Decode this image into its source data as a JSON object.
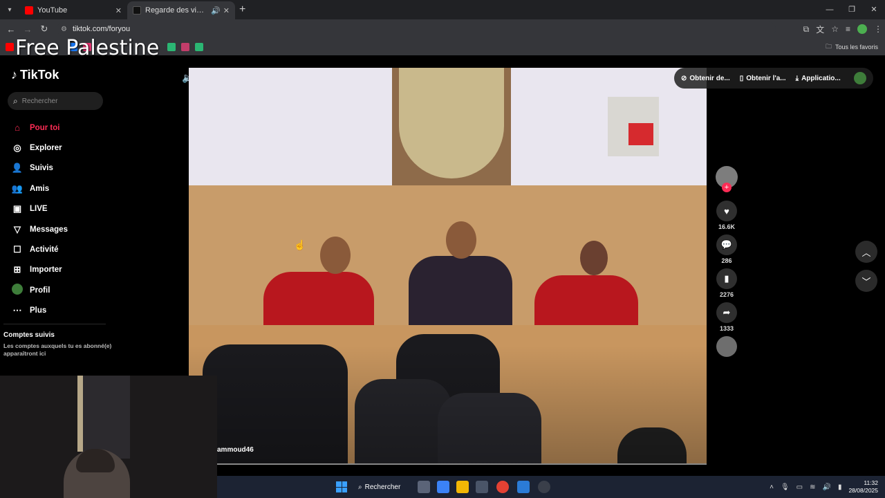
{
  "browser": {
    "tabs": [
      {
        "title": "YouTube",
        "favicon_color": "#ff0000",
        "active": false
      },
      {
        "title": "Regarde des vidéos tendan...",
        "favicon_color": "#111111",
        "active": true
      }
    ],
    "new_tab_symbol": "+",
    "url": "tiktok.com/foryou",
    "bookmarks_all_label": "Tous les favoris",
    "overlay_text": "Free Palestine"
  },
  "tiktok": {
    "logo_text": "TikTok",
    "search_placeholder": "Rechercher",
    "menu": [
      {
        "label": "Pour toi",
        "icon": "home-icon",
        "active": true
      },
      {
        "label": "Explorer",
        "icon": "compass-icon",
        "active": false
      },
      {
        "label": "Suivis",
        "icon": "following-icon",
        "active": false
      },
      {
        "label": "Amis",
        "icon": "friends-icon",
        "active": false
      },
      {
        "label": "LIVE",
        "icon": "live-icon",
        "active": false
      },
      {
        "label": "Messages",
        "icon": "messages-icon",
        "active": false
      },
      {
        "label": "Activité",
        "icon": "activity-icon",
        "active": false
      },
      {
        "label": "Importer",
        "icon": "upload-icon",
        "active": false
      },
      {
        "label": "Profil",
        "icon": "profile-avatar",
        "active": false
      },
      {
        "label": "Plus",
        "icon": "more-icon",
        "active": false
      }
    ],
    "followed": {
      "title": "Comptes suivis",
      "description": "Les comptes auxquels tu es abonné(e) apparaîtront ici"
    },
    "video_actions": [
      {
        "label": "Obtenir de...",
        "icon": "coin-icon"
      },
      {
        "label": "Obtenir l'a...",
        "icon": "phone-icon"
      },
      {
        "label": "Applicatio...",
        "icon": "download-icon"
      }
    ],
    "video": {
      "author": "ammoud46"
    },
    "side_actions": {
      "likes": "16.6K",
      "comments": "286",
      "saves": "2276",
      "shares": "1333"
    }
  },
  "taskbar": {
    "search_label": "Rechercher",
    "time": "11:32",
    "date": "28/08/2025"
  },
  "colors": {
    "accent": "#fe2c55",
    "taskbar": "#1c2333"
  }
}
